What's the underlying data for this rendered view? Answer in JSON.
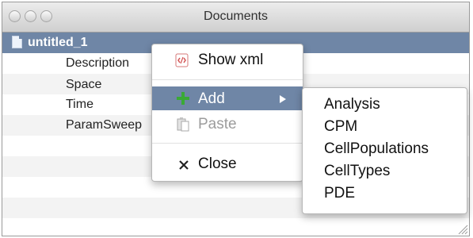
{
  "window": {
    "title": "Documents"
  },
  "tree": {
    "document": {
      "label": "untitled_1"
    },
    "children": [
      {
        "label": "Description"
      },
      {
        "label": "Space"
      },
      {
        "label": "Time"
      },
      {
        "label": "ParamSweep"
      }
    ]
  },
  "context_menu": {
    "show_xml": "Show xml",
    "add": "Add",
    "paste": "Paste",
    "close": "Close"
  },
  "add_submenu": {
    "items": [
      "Analysis",
      "CPM",
      "CellPopulations",
      "CellTypes",
      "PDE"
    ]
  },
  "colors": {
    "selection": "#6f86a6",
    "add_icon": "#3aaa35"
  },
  "icons": [
    "window-close-icon",
    "window-minimize-icon",
    "window-zoom-icon",
    "document-icon",
    "xml-icon",
    "add-plus-icon",
    "submenu-arrow-icon",
    "paste-icon",
    "close-x-icon",
    "resize-grip-icon"
  ]
}
